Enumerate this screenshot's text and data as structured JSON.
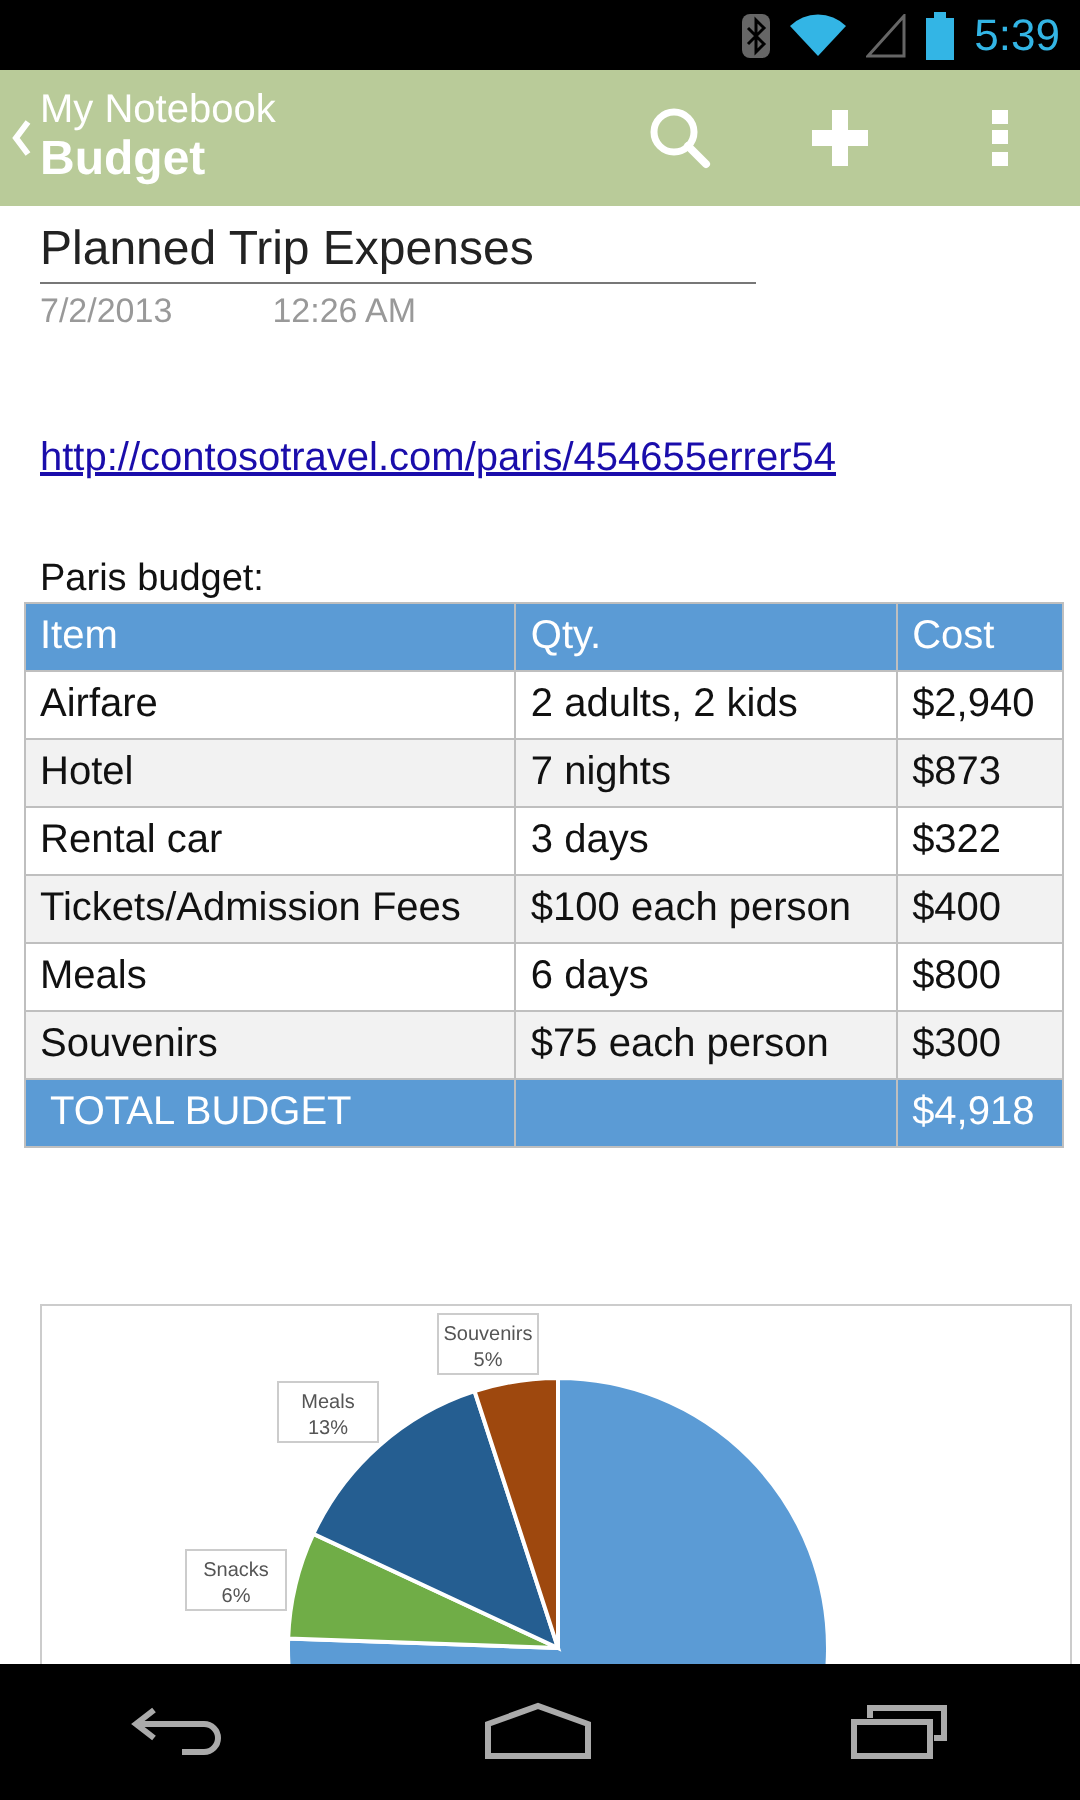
{
  "status_bar": {
    "time": "5:39"
  },
  "app_bar": {
    "notebook": "My Notebook",
    "section": "Budget"
  },
  "page": {
    "title": "Planned Trip Expenses",
    "date": "7/2/2013",
    "time": "12:26 AM",
    "link": "http://contosotravel.com/paris/454655errer54",
    "caption": "Paris budget:"
  },
  "table": {
    "columns": [
      "Item",
      "Qty.",
      "Cost"
    ],
    "rows": [
      [
        "Airfare",
        "2 adults, 2 kids",
        "$2,940"
      ],
      [
        "Hotel",
        "7 nights",
        "$873"
      ],
      [
        "Rental car",
        "3 days",
        "$322"
      ],
      [
        "Tickets/Admission Fees",
        "$100 each person",
        "$400"
      ],
      [
        "Meals",
        "6 days",
        "$800"
      ],
      [
        "Souvenirs",
        "$75 each person",
        "$300"
      ]
    ],
    "total": {
      "label": "TOTAL BUDGET",
      "cost": "$4,918"
    }
  },
  "chart": {
    "labels": [
      {
        "category": "Souvenirs",
        "percent": "5%"
      },
      {
        "category": "Meals",
        "percent": "13%"
      },
      {
        "category": "Snacks",
        "percent": "6%"
      }
    ]
  }
}
